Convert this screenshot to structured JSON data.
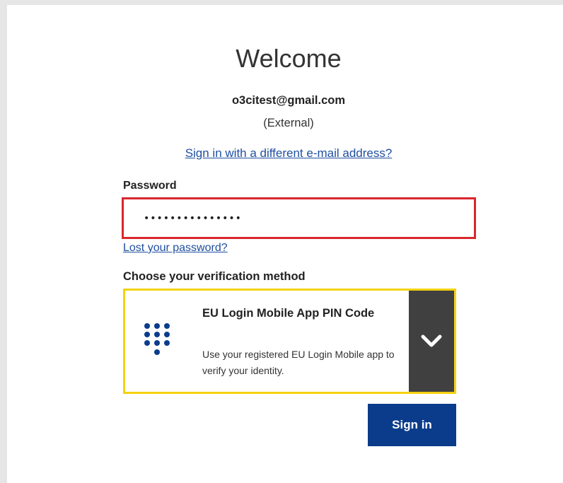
{
  "header": {
    "title": "Welcome",
    "email": "o3citest@gmail.com",
    "account_type": "(External)",
    "different_email_link": "Sign in with a different e-mail address?"
  },
  "password": {
    "label": "Password",
    "value": "•••••••••••••••",
    "error_border_color": "#d9262e",
    "lost_link": "Lost your password?"
  },
  "verification": {
    "label": "Choose your verification method",
    "selected_method": {
      "icon": "keypad-icon",
      "title": "EU Login Mobile App PIN Code",
      "description": "Use your registered EU Login Mobile app to verify your identity."
    },
    "dropdown_icon": "chevron-down-icon",
    "highlight_color": "#f5d20f"
  },
  "actions": {
    "signin_label": "Sign in",
    "signin_color": "#0b3c8c"
  }
}
